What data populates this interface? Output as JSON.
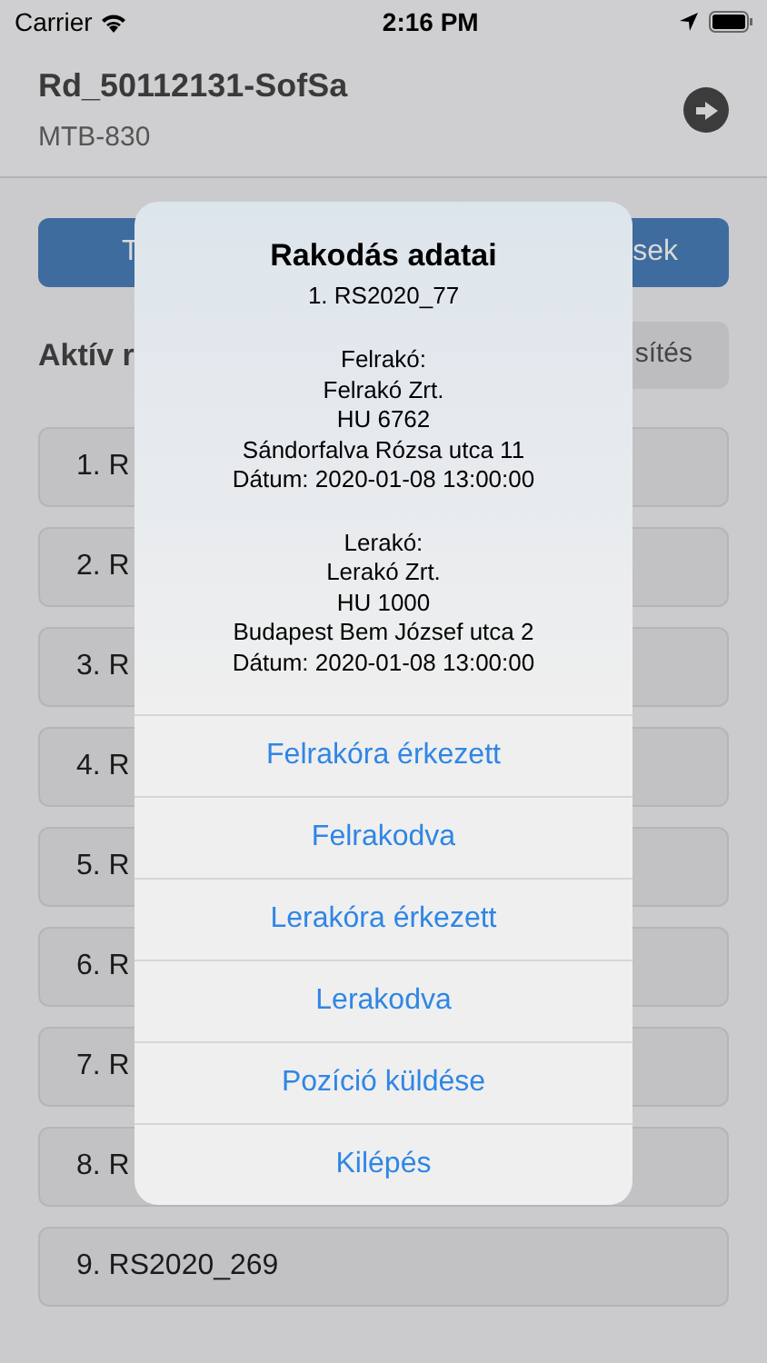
{
  "status_bar": {
    "carrier": "Carrier",
    "time": "2:16 PM"
  },
  "header": {
    "title": "Rd_50112131-SofSa",
    "subtitle": "MTB-830"
  },
  "top_buttons": [
    {
      "label": "T"
    },
    {
      "label": "sek"
    }
  ],
  "section": {
    "title": "Aktív r",
    "button": "sítés"
  },
  "list_items": [
    "1. R",
    "2. R",
    "3. R",
    "4. R",
    "5. R",
    "6. R",
    "7. R",
    "8. R",
    "9. RS2020_269"
  ],
  "dialog": {
    "title": "Rakodás adatai",
    "subtitle": "1. RS2020_77",
    "blocks": [
      [
        "Felrakó:",
        "Felrakó Zrt.",
        "HU 6762",
        "Sándorfalva Rózsa utca 11",
        "Dátum: 2020-01-08 13:00:00"
      ],
      [
        "Lerakó:",
        "Lerakó Zrt.",
        "HU 1000",
        "Budapest Bem József utca 2",
        "Dátum: 2020-01-08 13:00:00"
      ]
    ],
    "actions": [
      "Felrakóra érkezett",
      "Felrakodva",
      "Lerakóra érkezett",
      "Lerakodva",
      "Pozíció küldése",
      "Kilépés"
    ]
  }
}
